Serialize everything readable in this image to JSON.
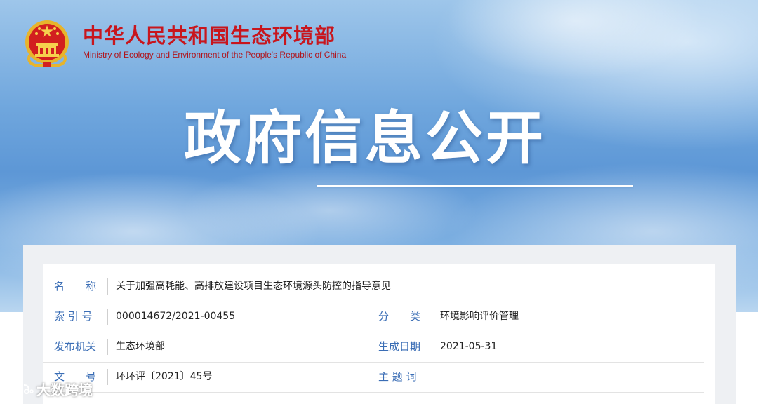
{
  "header": {
    "ministry_cn": "中华人民共和国生态环境部",
    "ministry_en": "Ministry of Ecology and Environment of the People's Republic of China",
    "hero_title": "政府信息公开"
  },
  "info": {
    "name_label": "名　　称",
    "name_value": "关于加强高耗能、高排放建设项目生态环境源头防控的指导意见",
    "index_label": "索 引 号",
    "index_value": "000014672/2021-00455",
    "category_label": "分　　类",
    "category_value": "环境影响评价管理",
    "issuer_label": "发布机关",
    "issuer_value": "生态环境部",
    "date_label": "生成日期",
    "date_value": "2021-05-31",
    "docno_label": "文　　号",
    "docno_value": "环环评〔2021〕45号",
    "keywords_label": "主 题 词",
    "keywords_value": ""
  },
  "watermark": {
    "text": "大数跨境"
  },
  "colors": {
    "brand_red": "#c8161d",
    "label_blue": "#3a6db5",
    "sky_blue": "#6fa6dd"
  },
  "icons": {
    "emblem": "national-emblem-icon",
    "watermark": "weibo-icon"
  }
}
